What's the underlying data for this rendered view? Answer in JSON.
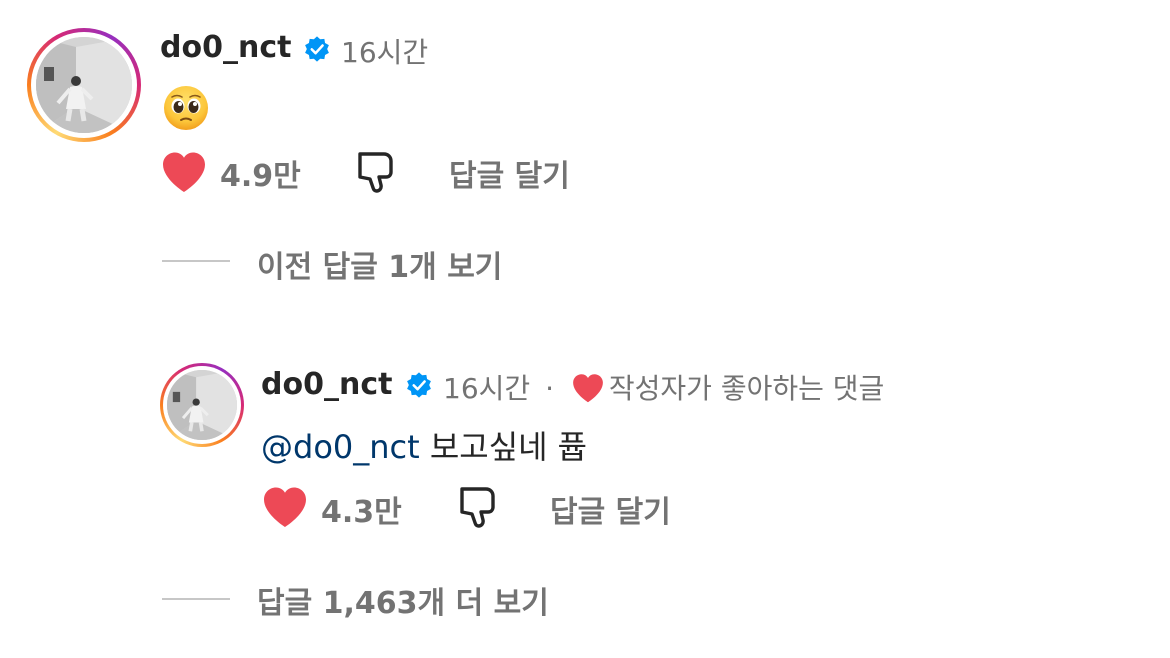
{
  "comment": {
    "username": "do0_nct",
    "time": "16시간",
    "emoji": "pleading-face",
    "likes": "4.9만",
    "reply_label": "답글 달기",
    "view_previous": "이전 답글 1개 보기"
  },
  "reply": {
    "username": "do0_nct",
    "time": "16시간",
    "separator": "·",
    "liked_by_author": "작성자가 좋아하는 댓글",
    "mention": "@do0_nct",
    "text": " 보고싶네 퓹",
    "likes": "4.3만",
    "reply_label": "답글 달기",
    "view_more": "답글 1,463개 더 보기"
  },
  "icons": {
    "like": "heart-icon",
    "dislike": "thumbs-down-icon",
    "verified": "verified-badge-icon"
  },
  "colors": {
    "heart": "#ed4956",
    "verified": "#0095f6",
    "mention": "#00376b",
    "muted": "#737373"
  }
}
